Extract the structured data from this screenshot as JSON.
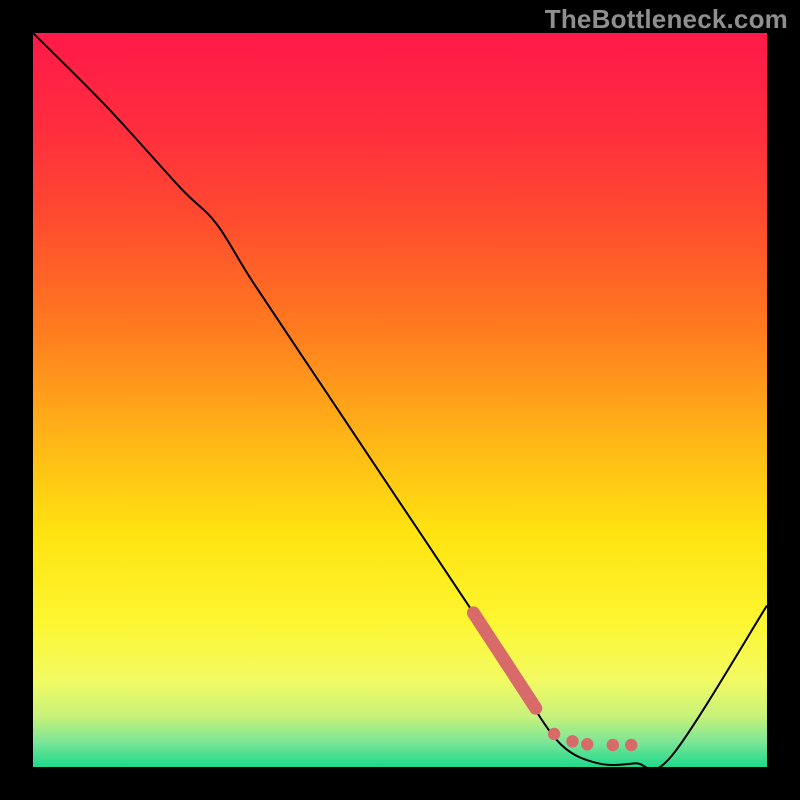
{
  "watermark": "TheBottleneck.com",
  "colors": {
    "frame": "#000000",
    "curve": "#000000",
    "marker": "#d96a6a",
    "gradient_stops": [
      {
        "offset": 0.0,
        "color": "#ff1a49"
      },
      {
        "offset": 0.12,
        "color": "#ff2b3f"
      },
      {
        "offset": 0.25,
        "color": "#ff4a2f"
      },
      {
        "offset": 0.4,
        "color": "#ff7a1f"
      },
      {
        "offset": 0.55,
        "color": "#ffb417"
      },
      {
        "offset": 0.68,
        "color": "#ffe310"
      },
      {
        "offset": 0.8,
        "color": "#fdf630"
      },
      {
        "offset": 0.88,
        "color": "#f3fb62"
      },
      {
        "offset": 0.93,
        "color": "#c9f27a"
      },
      {
        "offset": 0.965,
        "color": "#7ee696"
      },
      {
        "offset": 1.0,
        "color": "#1ed98c"
      }
    ]
  },
  "chart_data": {
    "type": "line",
    "title": "",
    "xlabel": "",
    "ylabel": "",
    "xlim": [
      0,
      100
    ],
    "ylim": [
      0,
      100
    ],
    "series": [
      {
        "name": "curve",
        "x": [
          0,
          10,
          20,
          25,
          30,
          40,
          50,
          60,
          67,
          72,
          77,
          82,
          87,
          100
        ],
        "y": [
          100,
          90,
          79,
          74,
          66,
          51,
          36,
          21,
          10,
          3,
          0.5,
          0.5,
          1.5,
          22
        ]
      }
    ],
    "markers": {
      "thick_segment": {
        "x": [
          60,
          68.5
        ],
        "y": [
          21,
          8
        ]
      },
      "dots": [
        {
          "x": 71.0,
          "y": 4.5
        },
        {
          "x": 73.5,
          "y": 3.5
        },
        {
          "x": 75.5,
          "y": 3.1
        },
        {
          "x": 79.0,
          "y": 3.0
        },
        {
          "x": 81.5,
          "y": 3.0
        }
      ]
    }
  }
}
